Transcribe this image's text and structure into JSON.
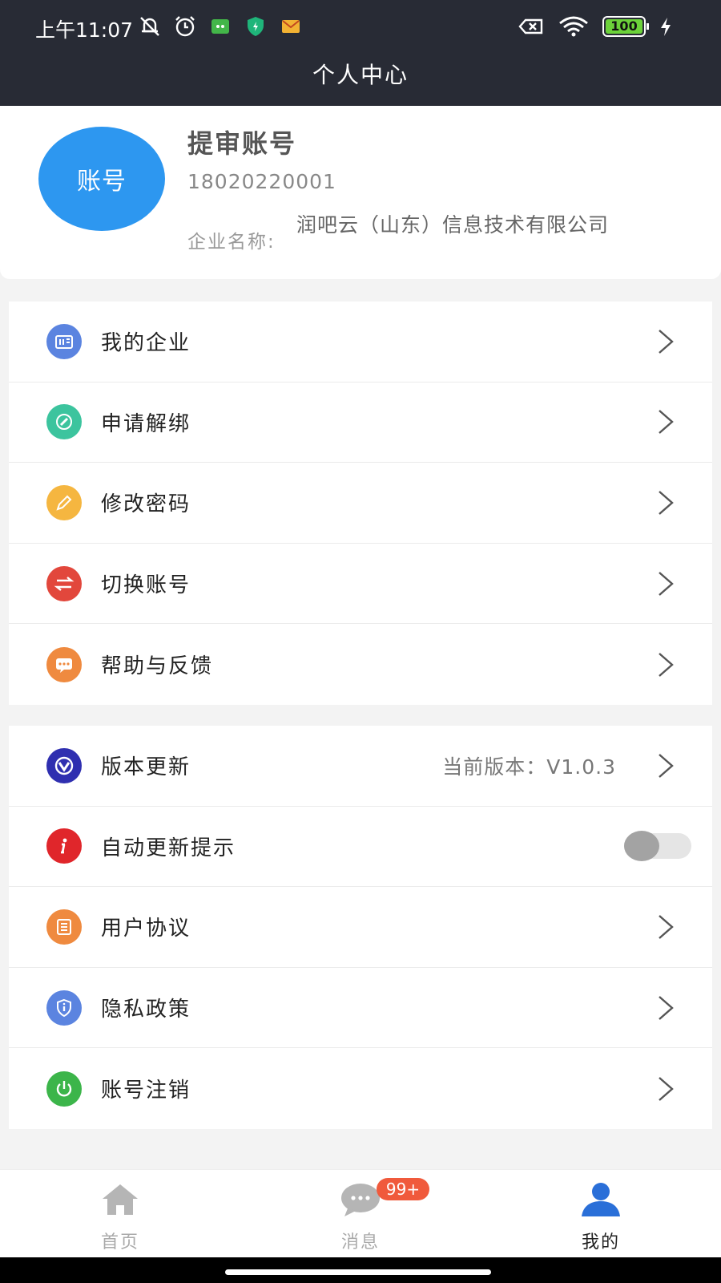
{
  "status_bar": {
    "time": "上午11:07",
    "battery": "100"
  },
  "header": {
    "title": "个人中心"
  },
  "profile": {
    "avatar_text": "账号",
    "name": "提审账号",
    "phone": "18020220001",
    "company_label": "企业名称:",
    "company_name": "润吧云（山东）信息技术有限公司"
  },
  "menu_group_1": [
    {
      "label": "我的企业",
      "icon": "building-icon",
      "color": "#5b84e0"
    },
    {
      "label": "申请解绑",
      "icon": "edit-icon",
      "color": "#3cc49e"
    },
    {
      "label": "修改密码",
      "icon": "pencil-icon",
      "color": "#f5b640"
    },
    {
      "label": "切换账号",
      "icon": "swap-icon",
      "color": "#e2473c"
    },
    {
      "label": "帮助与反馈",
      "icon": "chat-icon",
      "color": "#ef8a3f"
    }
  ],
  "menu_group_2": [
    {
      "label": "版本更新",
      "icon": "version-icon",
      "color": "#2f2fb0",
      "value": "当前版本：V1.0.3"
    },
    {
      "label": "自动更新提示",
      "icon": "info-icon",
      "color": "#e0262b",
      "toggle": false
    },
    {
      "label": "用户协议",
      "icon": "document-icon",
      "color": "#ef8a3f"
    },
    {
      "label": "隐私政策",
      "icon": "shield-icon",
      "color": "#5b84e0"
    },
    {
      "label": "账号注销",
      "icon": "power-icon",
      "color": "#3cb54a"
    }
  ],
  "tabbar": {
    "tabs": [
      {
        "label": "首页",
        "icon": "home-icon"
      },
      {
        "label": "消息",
        "icon": "message-icon",
        "badge": "99+"
      },
      {
        "label": "我的",
        "icon": "user-icon",
        "active": true
      }
    ]
  },
  "colors": {
    "header_bg": "#282b35",
    "avatar_bg": "#2d97f0",
    "active_tab": "#2a6fd8",
    "badge_bg": "#f05a3c"
  }
}
